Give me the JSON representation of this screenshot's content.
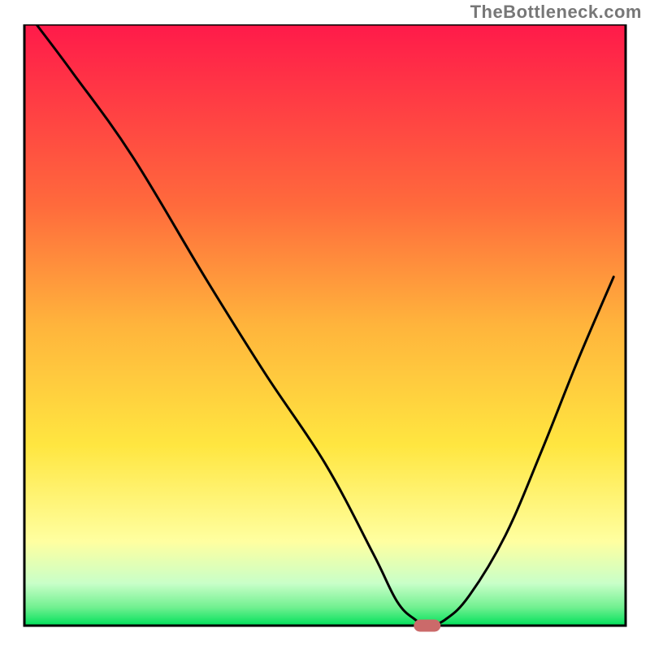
{
  "watermark": "TheBottleneck.com",
  "colors": {
    "gradient_top": "#ff1a4a",
    "gradient_orange": "#ff9a3c",
    "gradient_yellow": "#ffe640",
    "gradient_pale_yellow": "#ffffa0",
    "gradient_pale_green": "#b6ffb6",
    "gradient_green": "#00e05a",
    "curve": "#000000",
    "marker": "#cb6a6a",
    "border": "#000000"
  },
  "chart_data": {
    "type": "line",
    "title": "",
    "xlabel": "",
    "ylabel": "",
    "xlim": [
      0,
      100
    ],
    "ylim": [
      0,
      100
    ],
    "grid": false,
    "legend": false,
    "annotations": [
      {
        "kind": "marker",
        "x": 67,
        "y": 0,
        "shape": "rounded-rect",
        "color": "#cb6a6a"
      }
    ],
    "series": [
      {
        "name": "curve",
        "color": "#000000",
        "x": [
          2,
          8,
          18,
          30,
          40,
          50,
          58,
          62,
          65,
          67,
          70,
          74,
          80,
          86,
          92,
          98
        ],
        "y": [
          100,
          92,
          78,
          58,
          42,
          27,
          12,
          4,
          1,
          0,
          1,
          5,
          15,
          29,
          44,
          58
        ]
      }
    ],
    "background": {
      "type": "vertical-gradient",
      "stops": [
        {
          "offset": 0.0,
          "color": "#ff1a4a"
        },
        {
          "offset": 0.3,
          "color": "#ff6a3c"
        },
        {
          "offset": 0.5,
          "color": "#ffb43c"
        },
        {
          "offset": 0.7,
          "color": "#ffe640"
        },
        {
          "offset": 0.86,
          "color": "#ffffa0"
        },
        {
          "offset": 0.93,
          "color": "#c8ffc8"
        },
        {
          "offset": 0.97,
          "color": "#70f090"
        },
        {
          "offset": 1.0,
          "color": "#00e05a"
        }
      ]
    }
  }
}
